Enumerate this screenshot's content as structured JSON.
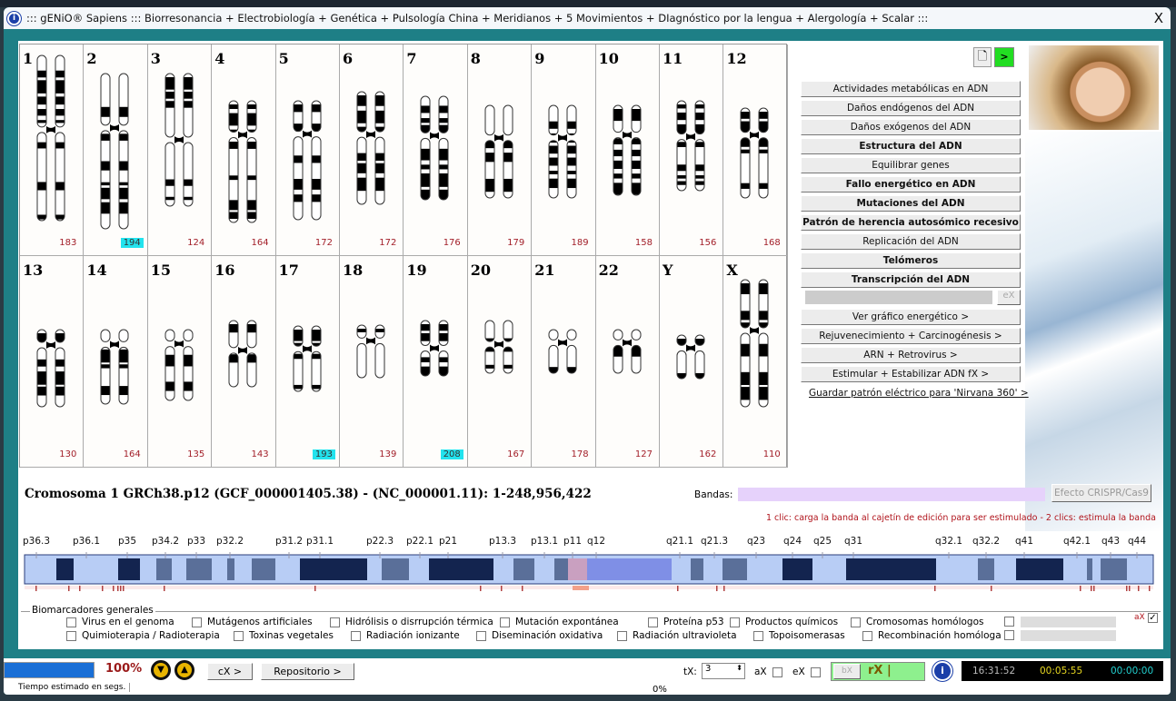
{
  "window": {
    "title": "::: gENiO® Sapiens ::: Biorresonancia + Electrobiología + Genética + Pulsología China + Meridianos + 5 Movimientos + DIagnóstico por la lengua + Alergología + Scalar :::",
    "close": "X"
  },
  "chromosomes": [
    {
      "label": "1",
      "count": "183",
      "highlight": false
    },
    {
      "label": "2",
      "count": "194",
      "highlight": true
    },
    {
      "label": "3",
      "count": "124",
      "highlight": false
    },
    {
      "label": "4",
      "count": "164",
      "highlight": false
    },
    {
      "label": "5",
      "count": "172",
      "highlight": false
    },
    {
      "label": "6",
      "count": "172",
      "highlight": false
    },
    {
      "label": "7",
      "count": "176",
      "highlight": false
    },
    {
      "label": "8",
      "count": "179",
      "highlight": false
    },
    {
      "label": "9",
      "count": "189",
      "highlight": false
    },
    {
      "label": "10",
      "count": "158",
      "highlight": false
    },
    {
      "label": "11",
      "count": "156",
      "highlight": false
    },
    {
      "label": "12",
      "count": "168",
      "highlight": false
    },
    {
      "label": "13",
      "count": "130",
      "highlight": false
    },
    {
      "label": "14",
      "count": "164",
      "highlight": false
    },
    {
      "label": "15",
      "count": "135",
      "highlight": false
    },
    {
      "label": "16",
      "count": "143",
      "highlight": false
    },
    {
      "label": "17",
      "count": "193",
      "highlight": true
    },
    {
      "label": "18",
      "count": "139",
      "highlight": false
    },
    {
      "label": "19",
      "count": "208",
      "highlight": true
    },
    {
      "label": "20",
      "count": "167",
      "highlight": false
    },
    {
      "label": "21",
      "count": "178",
      "highlight": false
    },
    {
      "label": "22",
      "count": "127",
      "highlight": false
    },
    {
      "label": "Y",
      "count": "162",
      "highlight": false
    },
    {
      "label": "X",
      "count": "110",
      "highlight": false
    }
  ],
  "highlight_color": "#22e3ee",
  "right_panel": {
    "top_icons": [
      {
        "icon": "document-icon"
      },
      {
        "icon": "play-icon",
        "label": ">",
        "color": "#22dd22"
      }
    ],
    "buttons": [
      {
        "label": "Actividades metabólicas en ADN",
        "bold": false
      },
      {
        "label": "Daños endógenos del ADN",
        "bold": false
      },
      {
        "label": "Daños exógenos del ADN",
        "bold": false
      },
      {
        "label": "Estructura del ADN",
        "bold": true
      },
      {
        "label": "Equilibrar genes",
        "bold": false
      },
      {
        "label": "Fallo energético en ADN",
        "bold": true
      },
      {
        "label": "Mutaciones del ADN",
        "bold": true
      },
      {
        "label": "Patrón de herencia autosómico recesivo",
        "bold": true
      },
      {
        "label": "Replicación del ADN",
        "bold": false
      },
      {
        "label": "Telómeros",
        "bold": true
      },
      {
        "label": "Transcripción del ADN",
        "bold": true
      }
    ],
    "ex_label": "eX",
    "nav_buttons": [
      "Ver gráfico energético >",
      "Rejuvenecimiento + Carcinogénesis >",
      "ARN + Retrovirus >",
      "Estimular + Estabilizar ADN fX >"
    ],
    "link": "Guardar patrón eléctrico para 'Nirvana 360' >"
  },
  "chromosome_detail": {
    "title": "Cromosoma 1 GRCh38.p12 (GCF_000001405.38) - (NC_000001.11): 1-248,956,422",
    "bandas_label": "Bandas:",
    "bandas_value": "",
    "crispr_button": "Efecto CRISPR/Cas9",
    "hint": "1 clic: carga la banda al cajetín de edición para ser estimulado - 2 clics: estimula la banda",
    "band_labels": [
      "p36.3",
      "p36.1",
      "p35",
      "p34.2",
      "p33",
      "p32.2",
      "p31.2",
      "p31.1",
      "p22.3",
      "p22.1",
      "p21",
      "p13.3",
      "p13.1",
      "p11",
      "q12",
      "q21.1",
      "q21.3",
      "q23",
      "q24",
      "q25",
      "q31",
      "q32.1",
      "q32.2",
      "q41",
      "q42.1",
      "q43",
      "q44"
    ]
  },
  "biomarkers": {
    "legend": "Biomarcadores generales",
    "row1": [
      "Virus en el genoma",
      "Mutágenos artificiales",
      "Hidrólisis o disrrupción térmica",
      "Mutación expontánea",
      "Proteína p53",
      "Productos químicos",
      "Cromosomas homólogos"
    ],
    "row2": [
      "Quimioterapia / Radioterapia",
      "Toxinas vegetales",
      "Radiación ionizante",
      "Diseminación oxidativa",
      "Radiación ultravioleta",
      "Topoisomerasas",
      "Recombinación homóloga"
    ],
    "ax_label": "aX",
    "ax_checked": true
  },
  "status": {
    "progress_percent": 100,
    "progress_label": "100%",
    "cx_button": "cX >",
    "repo_button": "Repositorio >",
    "estimate_label": "Tiempo estimado en segs.",
    "bottom_percent": "0%",
    "tx_label": "tX:",
    "tx_value": "3",
    "ax_label": "aX",
    "ex_label": "eX",
    "bx_label": "bX",
    "rx_label": "rX |",
    "clock": "16:31:52",
    "elapsed": "00:05:55",
    "remaining": "00:00:00"
  }
}
